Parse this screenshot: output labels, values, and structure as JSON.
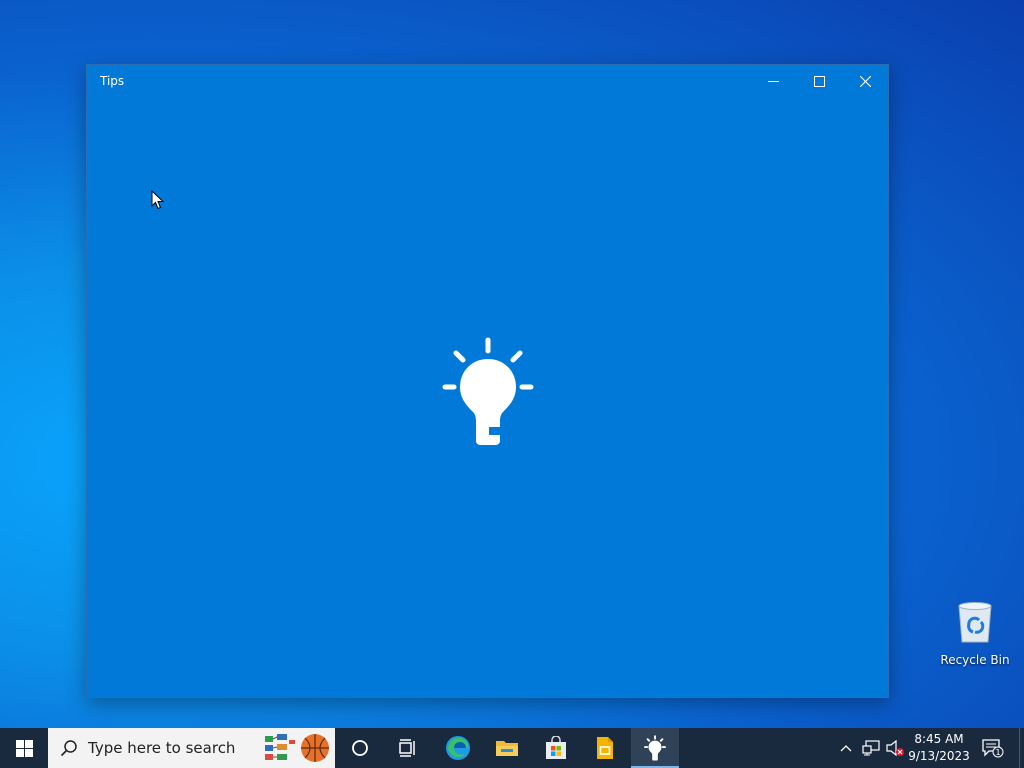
{
  "window": {
    "title": "Tips",
    "controls": [
      "minimize-icon",
      "maximize-icon",
      "close-icon"
    ],
    "splash_icon": "lightbulb-icon",
    "background_color": "#0179d8"
  },
  "desktop": {
    "icons": [
      {
        "label": "Recycle Bin",
        "icon": "recycle-bin-icon"
      }
    ]
  },
  "taskbar": {
    "search_placeholder": "Type here to search",
    "pinned": [
      {
        "name": "cortana",
        "icon": "circle-icon"
      },
      {
        "name": "task-view",
        "icon": "task-view-icon"
      },
      {
        "name": "edge",
        "icon": "edge-icon"
      },
      {
        "name": "file-explorer",
        "icon": "folder-icon"
      },
      {
        "name": "microsoft-store",
        "icon": "store-icon"
      },
      {
        "name": "sticky",
        "icon": "slides-icon"
      },
      {
        "name": "tips",
        "icon": "lightbulb-icon",
        "active": true
      }
    ],
    "clock": {
      "time": "8:45 AM",
      "date": "9/13/2023"
    },
    "notification_count": "1"
  }
}
